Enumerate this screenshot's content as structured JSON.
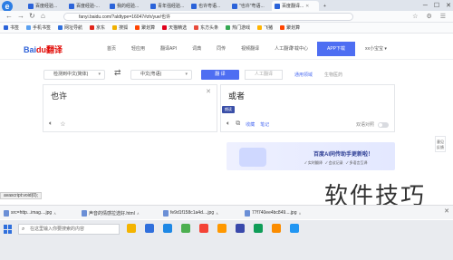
{
  "browser": {
    "tabs": [
      {
        "label": "百度经验...",
        "active": false
      },
      {
        "label": "百度经验-...",
        "active": false
      },
      {
        "label": "我的经验...",
        "active": false
      },
      {
        "label": "青年强经验...",
        "active": false
      },
      {
        "label": "也许粤语...",
        "active": false
      },
      {
        "label": "\"也许\"粤语...",
        "active": false
      },
      {
        "label": "百度翻译...",
        "active": true
      }
    ],
    "url": "fanyi.baidu.com/?aldtype=16047#zh/yue/也许",
    "bookmarks": [
      {
        "label": "书签",
        "color": "#2b63d9"
      },
      {
        "label": "手机书签",
        "color": "#5aa0f0"
      },
      {
        "label": "网址导航",
        "color": "#2f6fdc"
      },
      {
        "label": "京东",
        "color": "#e1251b"
      },
      {
        "label": "搜狐",
        "color": "#f0b000"
      },
      {
        "label": "聚划算",
        "color": "#ff4400"
      },
      {
        "label": "天猫精选",
        "color": "#e0001b"
      },
      {
        "label": "东方头条",
        "color": "#e84b3c"
      },
      {
        "label": "热门游戏",
        "color": "#35a853"
      },
      {
        "label": "飞猪",
        "color": "#ffb400"
      },
      {
        "label": "聚划算",
        "color": "#ff4400"
      }
    ]
  },
  "header": {
    "logo_main": "Bai",
    "logo_accent": "du翻译",
    "nav": [
      "首页",
      "轻应用",
      "翻译API",
      "词典",
      "同传",
      "视频翻译",
      "人工翻译"
    ],
    "download": "下载中心",
    "app_button": "APP下载",
    "user": "xx小宝宝 ▾"
  },
  "translator": {
    "source_lang": "检测到中文(简体)",
    "target_lang": "中文(粤语)",
    "translate_button": "翻 译",
    "manual_button": "人工翻译",
    "domain_link": "通用领域",
    "domain_select": "生物医药",
    "source_text": "也许",
    "result_text": "或者",
    "tooltip": "朗读",
    "result_actions": [
      "收藏",
      "笔记"
    ],
    "double_example": "双语对照"
  },
  "ad": {
    "title": "百度AI同传助手更新啦！",
    "features": [
      "✓ 实时翻译",
      "✓ 会议记录",
      "✓ 多语言互译"
    ]
  },
  "side_tool": "意见反馈",
  "status_url": "avascript:void(0);",
  "downloads": [
    "src=http...imag....jpg",
    "声音的情感拉选好.html",
    "fe9d1f158c1a4d....jpg",
    "77f740ee4bc849....jpg"
  ],
  "taskbar": {
    "search_placeholder": "在这里输入你要搜索的内容",
    "app_colors": [
      "#f4b400",
      "#2f6fdc",
      "#1e88e5",
      "#4caf50",
      "#f44336",
      "#ff9800",
      "#3949ab",
      "#0f9d58",
      "#fb8c00",
      "#2196f3"
    ]
  },
  "watermark": "软件技巧"
}
